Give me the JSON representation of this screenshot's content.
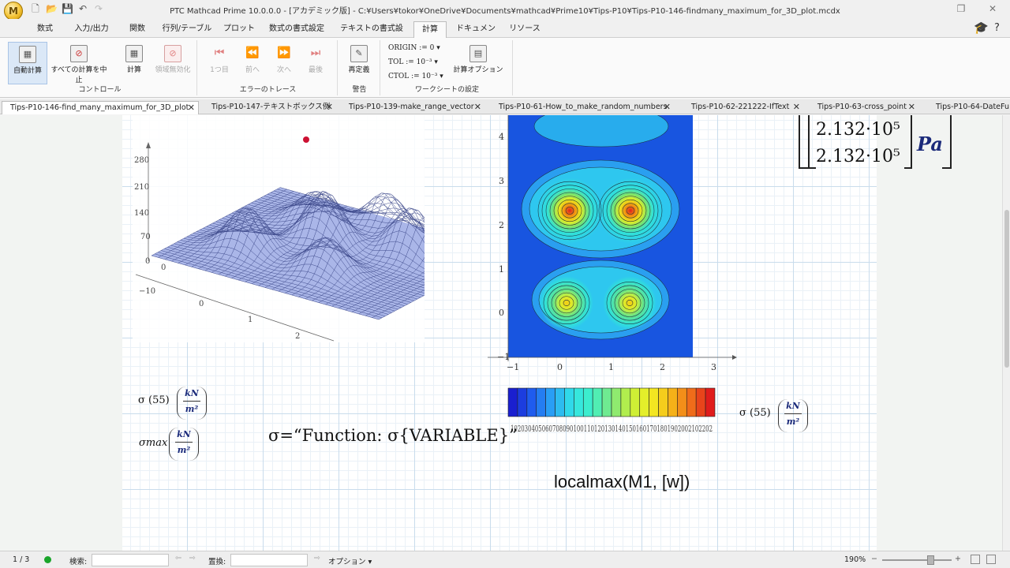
{
  "app": {
    "logo_letter": "M",
    "window_title": "PTC Mathcad Prime 10.0.0.0 - [アカデミック版] - C:¥Users¥tokor¥OneDrive¥Documents¥mathcad¥Prime10¥Tips-P10¥Tips-P10-146-findmany_maximum_for_3D_plot.mcdx"
  },
  "ribbon_tabs": [
    "数式",
    "入力/出力",
    "関数",
    "行列/テーブル",
    "プロット",
    "数式の書式設定",
    "テキストの書式設定",
    "計算",
    "ドキュメント",
    "リソース"
  ],
  "ribbon": {
    "auto_calc": "自動計算",
    "stop_all": "すべての計算を中止",
    "calculate": "計算",
    "disable_region": "領域無効化",
    "group_control": "コントロール",
    "first": "1つ目",
    "prev": "前へ",
    "next": "次へ",
    "last": "最後",
    "group_trace": "エラーのトレース",
    "redefine": "再定義",
    "group_warning": "警告",
    "origin": "ORIGIN := 0",
    "tol": "TOL := 10⁻³",
    "ctol": "CTOL := 10⁻³",
    "calc_options": "計算オプション",
    "group_worksheet": "ワークシートの設定"
  },
  "doc_tabs": [
    "Tips-P10-146-find_many_maximum_for_3D_plot",
    "Tips-P10-147-テキストボックス例",
    "Tips-P10-139-make_range_vector",
    "Tips-P10-61-How_to_make_random_numbers",
    "Tips-P10-62-221222-IfText",
    "Tips-P10-63-cross_point",
    "Tips-P10-64-DateFu"
  ],
  "plot3d": {
    "z_ticks": [
      "280",
      "210",
      "140",
      "70",
      "0"
    ],
    "x_ticks": [
      "−10",
      "0",
      "1",
      "2"
    ],
    "y_tick": "0",
    "max_point_color": "#cc1133"
  },
  "contour": {
    "y_ticks": [
      "4",
      "3",
      "2",
      "1",
      "0",
      "−1"
    ],
    "x_ticks": [
      "−1",
      "0",
      "1",
      "2",
      "3"
    ],
    "colorbar_labels": "1020304050607080901001101201301401501601701801902002102202"
  },
  "math": {
    "pa_values": [
      "2.132·10⁵",
      "2.132·10⁵"
    ],
    "pa_unit": "Pa",
    "sigma55": "σ (55)",
    "sigma_max": "σmax",
    "unit_num": "kN",
    "unit_den": "m²",
    "sigma_def": "σ=“Function: σ{VARIABLE}”",
    "sigma55_right": "σ (55)",
    "localmax": "localmax(M1, [w])"
  },
  "status": {
    "page": "1 / 3",
    "search_label": "検索:",
    "replace_label": "置換:",
    "options": "オプション",
    "zoom": "190%"
  }
}
